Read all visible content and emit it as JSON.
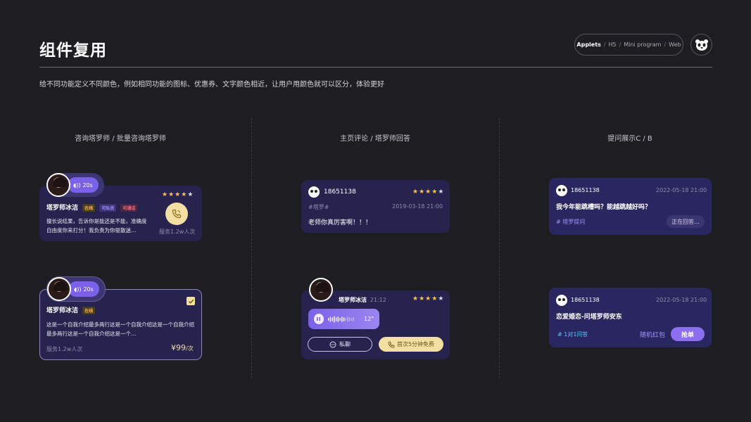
{
  "header": {
    "title": "组件复用",
    "nav": {
      "active": "Applets",
      "sep": "/",
      "items": [
        "H5",
        "Mini program",
        "Web"
      ]
    },
    "description": "给不同功能定义不同颜色，例如相同功能的图标、优惠券、文字颜色相近，让用户用颜色就可以区分，体验更好"
  },
  "columns": {
    "col1": "咨询塔罗师 / 批量咨询塔罗师",
    "col2": "主页评论 / 塔罗师回答",
    "col3": "提问展示C / B"
  },
  "card1": {
    "voice": "20s",
    "name": "塔罗师冰洁",
    "tags": [
      "在线",
      "可私信",
      "可通话"
    ],
    "rating": 4,
    "desc": "擅长说结果，告诉你是能还是不能，准确度自由度你来打分！我负责为你驱散迷…",
    "served": "服务1.2w人次",
    "call_icon": "phone-icon"
  },
  "card2": {
    "voice": "20s",
    "name": "塔罗师冰洁",
    "tag": "在线",
    "desc": "这是一个自我介绍最多两行这是一个自我介绍这是一个自我介绍最多两行这是一个自我介绍这是一个…",
    "served": "服务1.2w人次",
    "price": "¥99",
    "unit": "/次",
    "checked": true
  },
  "card3": {
    "user": "18651138",
    "rating": 4,
    "topic": "#塔罗#",
    "time": "2019-03-18 21:00",
    "comment": "老师你真厉害啊！！！"
  },
  "card4": {
    "name": "塔罗师冰洁",
    "time": "21:12",
    "rating": 4,
    "duration": "12\"",
    "chat_label": "私聊",
    "call_label": "首次5分钟免费"
  },
  "card5": {
    "user": "18651138",
    "time": "2022-05-18 21:00",
    "question": "我今年能跳槽吗？能越跳越好吗？",
    "topic": "# 塔罗提问",
    "status": "正在回答..."
  },
  "card6": {
    "user": "18651138",
    "time": "2022-05-18 21:00",
    "question": "恋爱婚恋-问塔罗师安东",
    "topic": "# 1对1问答",
    "reward": "随机红包",
    "action": "抢单"
  },
  "colors": {
    "bg": "#1e1e22",
    "card": "#27234f",
    "accent": "#7a61e8",
    "gold": "#f3dfa2",
    "star": "#ffc53a"
  }
}
